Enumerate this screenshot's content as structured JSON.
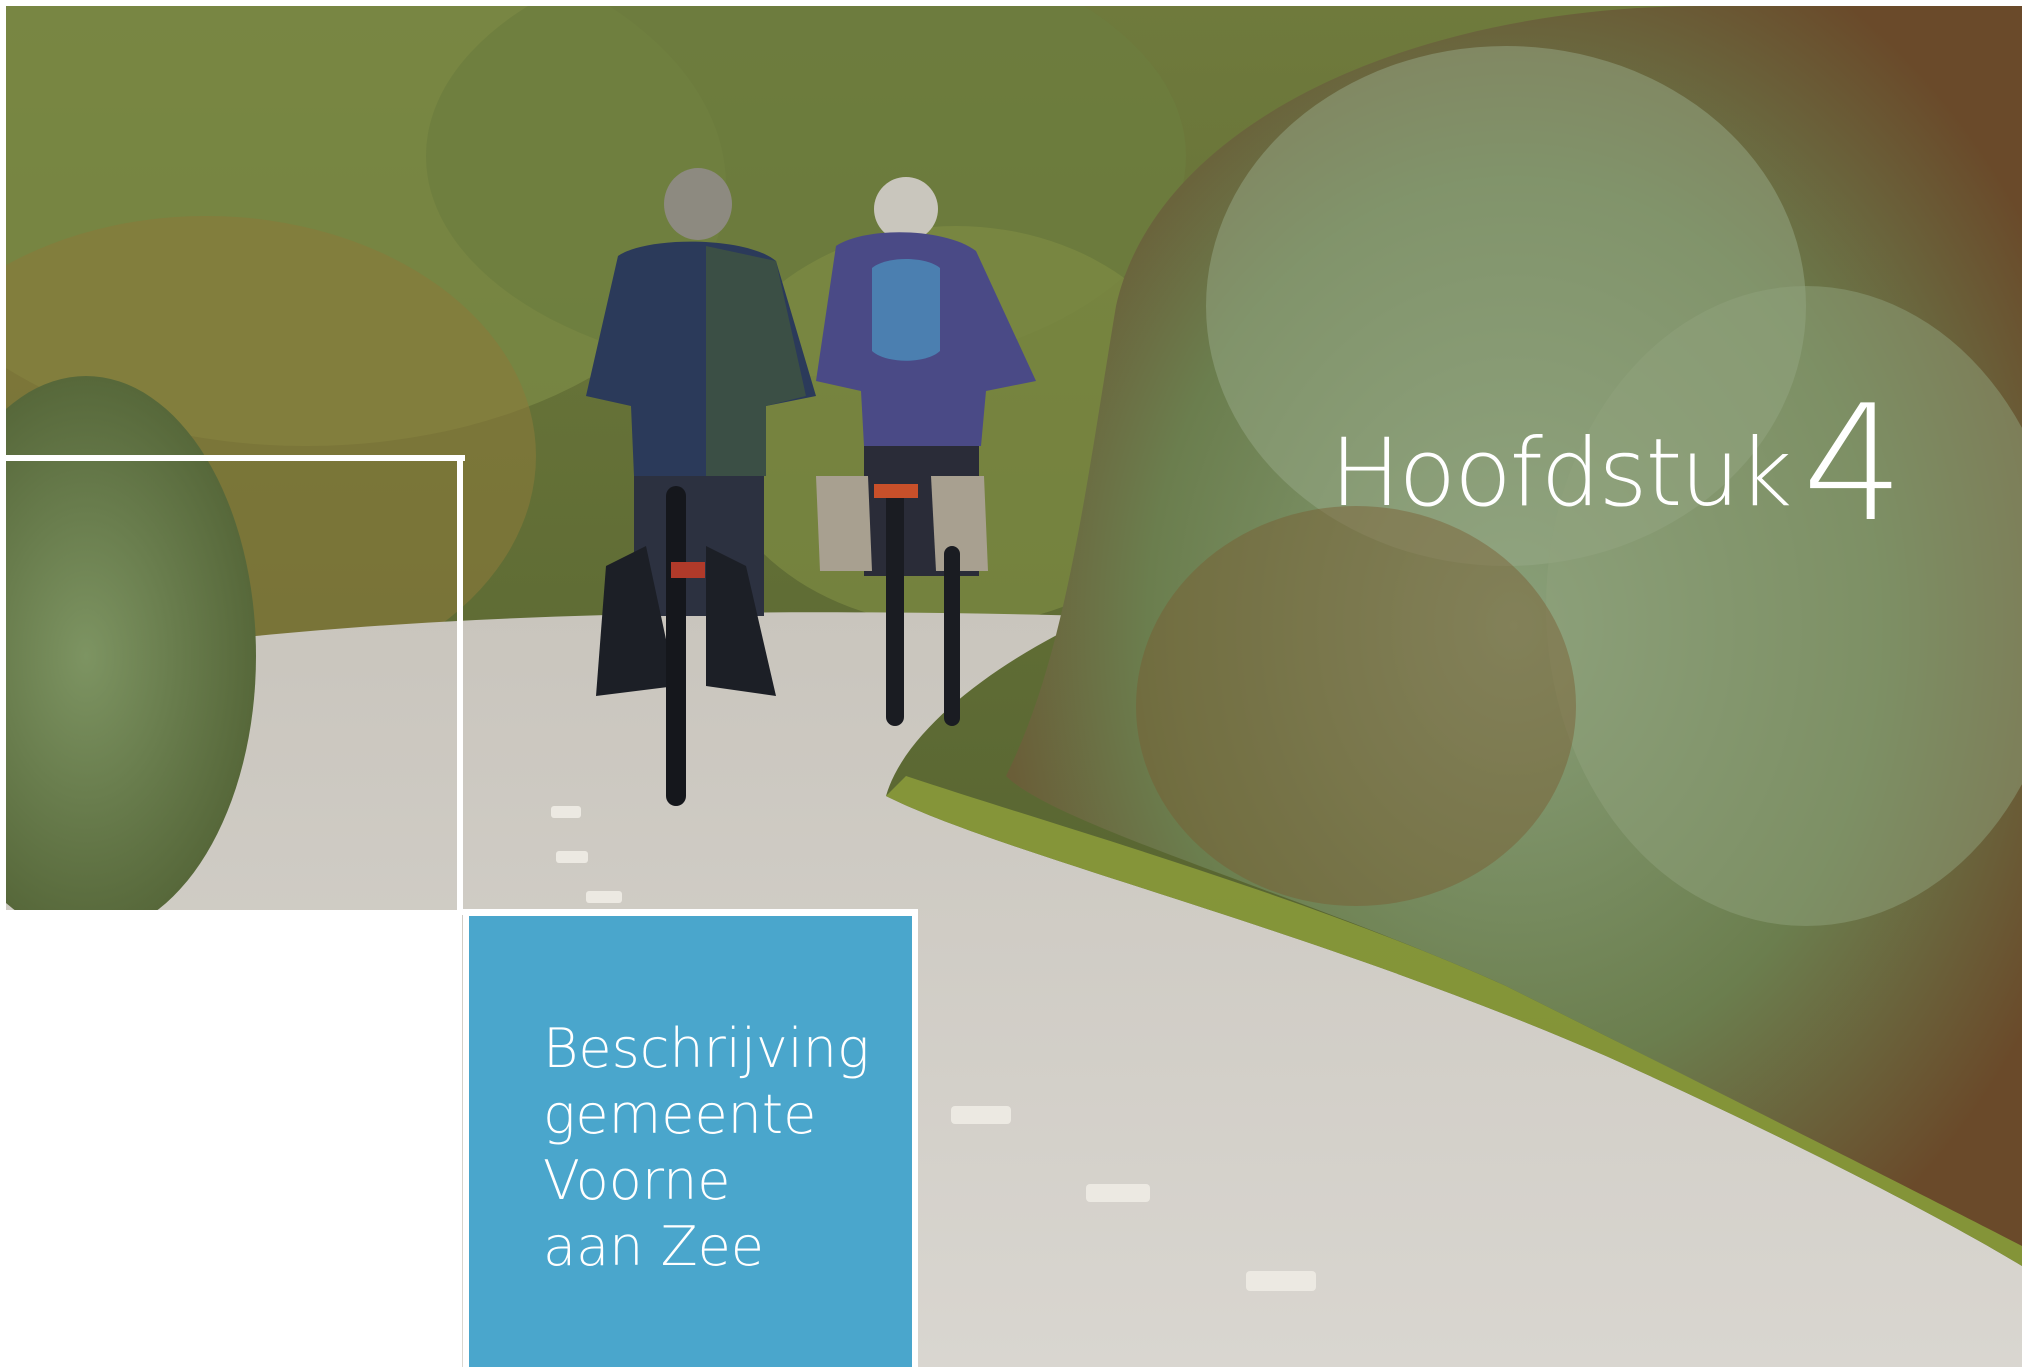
{
  "chapter": {
    "word": "Hoofdstuk",
    "number": "4"
  },
  "title_lines": [
    "Beschrijving",
    "gemeente",
    "Voorne",
    "aan Zee"
  ],
  "colors": {
    "accent_box": "#4aa6cc",
    "frame": "#ffffff"
  },
  "photo_description_icon": "cyclists-photo"
}
